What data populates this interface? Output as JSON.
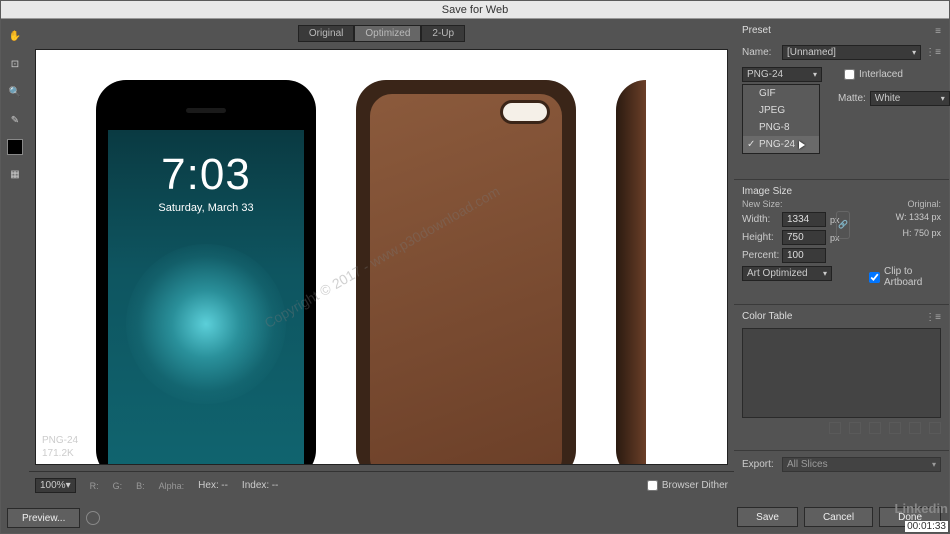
{
  "title": "Save for Web",
  "tabs": {
    "original": "Original",
    "optimized": "Optimized",
    "twoup": "2-Up"
  },
  "preview_info": {
    "format": "PNG-24",
    "size": "171.2K"
  },
  "phone": {
    "time": "7:03",
    "date": "Saturday, March 33"
  },
  "watermark": "Copyright © 2017 - www.p30download.com",
  "bottom": {
    "zoom": "100%",
    "r": "R:",
    "g": "G:",
    "b": "B:",
    "alpha": "Alpha:",
    "hex": "Hex:",
    "index": "Index:",
    "dash": "--",
    "browser_dither": "Browser Dither",
    "preview_btn": "Preview..."
  },
  "preset": {
    "section": "Preset",
    "name_label": "Name:",
    "name_value": "[Unnamed]",
    "format_selected": "PNG-24",
    "options": [
      "GIF",
      "JPEG",
      "PNG-8",
      "PNG-24"
    ],
    "interlaced": "Interlaced",
    "matte_label": "Matte:",
    "matte_value": "White"
  },
  "image_size": {
    "section": "Image Size",
    "new_size": "New Size:",
    "original_label": "Original:",
    "width_label": "Width:",
    "width": "1334",
    "height_label": "Height:",
    "height": "750",
    "percent_label": "Percent:",
    "percent": "100",
    "px": "px",
    "orig_w": "W:  1334 px",
    "orig_h": "H:   750 px",
    "quality": "Art Optimized",
    "clip": "Clip to Artboard"
  },
  "color_table": {
    "section": "Color Table"
  },
  "export": {
    "label": "Export:",
    "value": "All Slices"
  },
  "buttons": {
    "save": "Save",
    "cancel": "Cancel",
    "done": "Done"
  },
  "branding": "Linkedin",
  "timecode": "00:01:33"
}
